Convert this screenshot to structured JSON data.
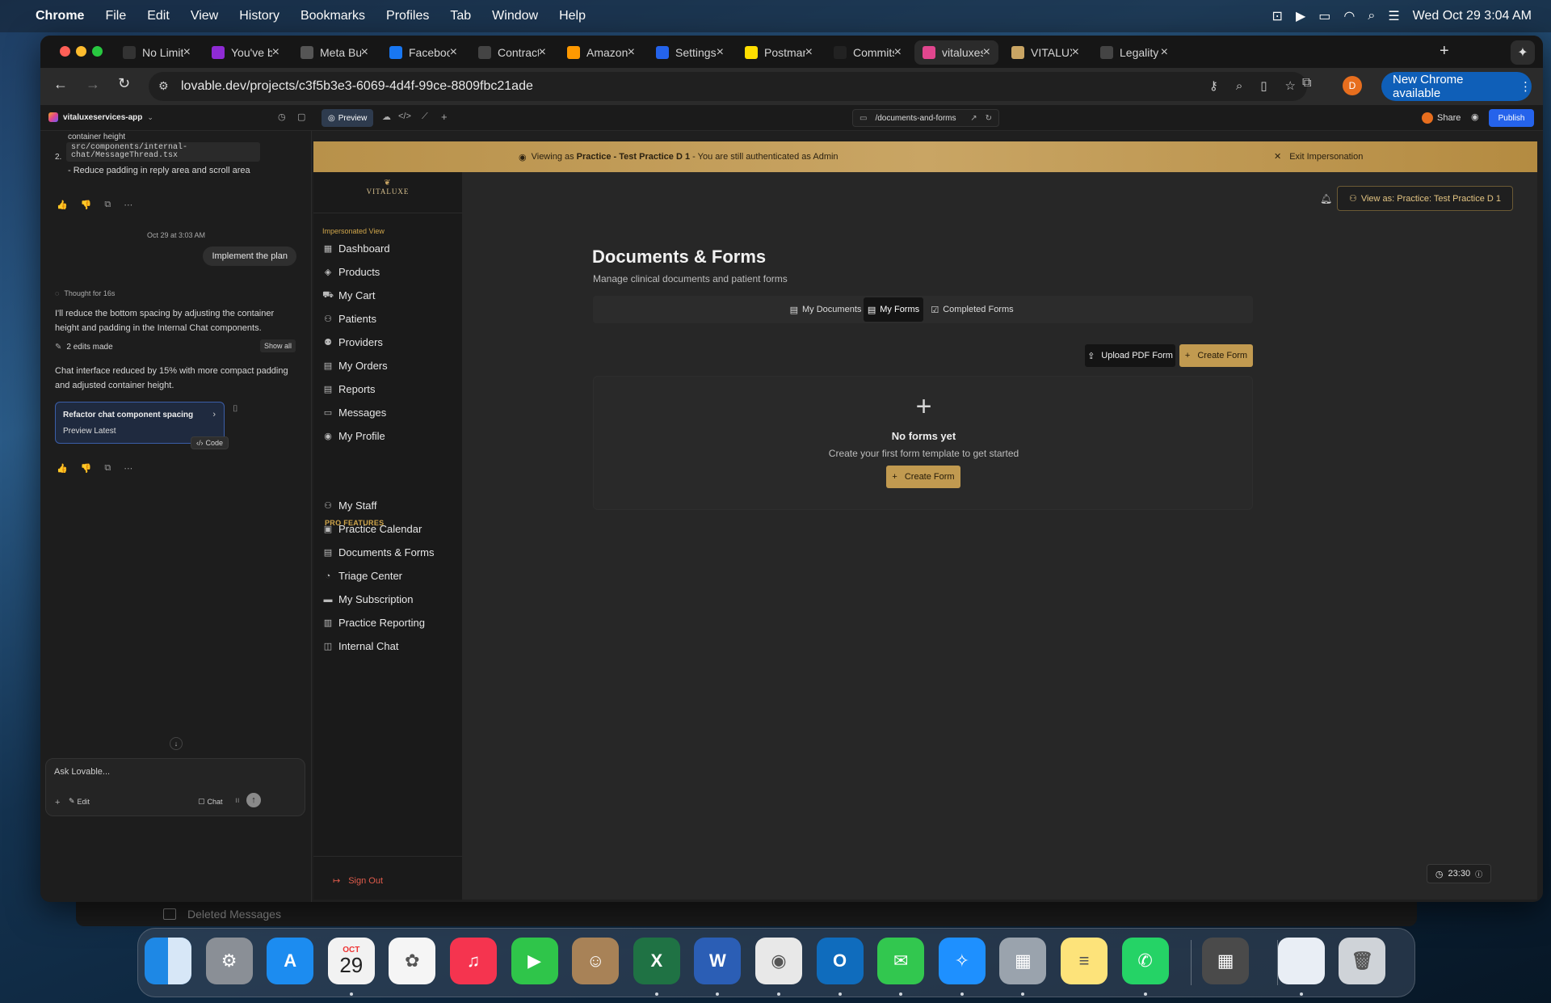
{
  "menubar": {
    "app": "Chrome",
    "items": [
      "File",
      "Edit",
      "View",
      "History",
      "Bookmarks",
      "Profiles",
      "Tab",
      "Window",
      "Help"
    ],
    "clock": "Wed Oct 29  3:04 AM"
  },
  "tabs": [
    {
      "label": "No Limit",
      "icon": "nlc-icon",
      "color": "#333"
    },
    {
      "label": "You've b",
      "icon": "app-icon",
      "color": "#8e2bd4"
    },
    {
      "label": "Meta Bus",
      "icon": "meta-icon",
      "color": "#555"
    },
    {
      "label": "Faceboo",
      "icon": "facebook-icon",
      "color": "#1877f2"
    },
    {
      "label": "Contract",
      "icon": "openai-icon",
      "color": "#444"
    },
    {
      "label": "Amazon",
      "icon": "amazon-icon",
      "color": "#ff9900"
    },
    {
      "label": "Settings",
      "icon": "settings-icon",
      "color": "#2463eb"
    },
    {
      "label": "Postmar",
      "icon": "postmark-icon",
      "color": "#ffde00"
    },
    {
      "label": "Commits",
      "icon": "github-icon",
      "color": "#222"
    },
    {
      "label": "vitaluxes",
      "icon": "lovable-icon",
      "color": "#e0468e"
    },
    {
      "label": "VITALUX",
      "icon": "vitalux-icon",
      "color": "#c9a564"
    },
    {
      "label": "Legality",
      "icon": "openai-icon",
      "color": "#444"
    }
  ],
  "address": {
    "url": "lovable.dev/projects/c3f5b3e3-6069-4d4f-99ce-8809fbc21ade",
    "profile": "D",
    "update": "New Chrome available"
  },
  "lovable": {
    "project": "vitaluxeservices-app",
    "preview": "Preview",
    "route": "/documents-and-forms",
    "share": "Share",
    "publish": "Publish"
  },
  "chat": {
    "line0": "container height",
    "code_path": "src/components/internal-chat/MessageThread.tsx",
    "num": "2.",
    "reduce": "- Reduce padding in reply area and scroll area",
    "timestamp": "Oct 29 at 3:03 AM",
    "user_msg": "Implement the plan",
    "thought": "Thought for 16s",
    "reply": "I'll reduce the bottom spacing by adjusting the container height and padding in the Internal Chat components.",
    "edits": "2 edits made",
    "show_all": "Show all",
    "summary": "Chat interface reduced by 15% with more compact padding and adjusted container height.",
    "card_title": "Refactor chat component spacing",
    "card_sub": "Preview Latest",
    "code_btn": "Code",
    "input_placeholder": "Ask Lovable...",
    "edit_btn": "Edit",
    "chat_btn": "Chat"
  },
  "app": {
    "banner_prefix": "Viewing as ",
    "banner_bold": "Practice - Test Practice D 1",
    "banner_suffix": " - You are still authenticated as Admin",
    "exit": "Exit Impersonation",
    "logo": "VITALUXE",
    "imp_view": "Impersonated View",
    "nav": [
      {
        "label": "Dashboard",
        "icon": "grid-icon"
      },
      {
        "label": "Products",
        "icon": "box-icon"
      },
      {
        "label": "My Cart",
        "icon": "cart-icon"
      },
      {
        "label": "Patients",
        "icon": "users-icon"
      },
      {
        "label": "Providers",
        "icon": "provider-icon"
      },
      {
        "label": "My Orders",
        "icon": "document-icon"
      },
      {
        "label": "Reports",
        "icon": "document-icon"
      },
      {
        "label": "Messages",
        "icon": "message-icon"
      },
      {
        "label": "My Profile",
        "icon": "profile-icon"
      }
    ],
    "pro_label": "PRO FEATURES",
    "pro_nav": [
      {
        "label": "My Staff",
        "icon": "users-icon"
      },
      {
        "label": "Practice Calendar",
        "icon": "calendar-icon"
      },
      {
        "label": "Documents & Forms",
        "icon": "document-icon"
      },
      {
        "label": "Triage Center",
        "icon": "alert-icon"
      },
      {
        "label": "My Subscription",
        "icon": "card-icon"
      },
      {
        "label": "Practice Reporting",
        "icon": "chart-icon"
      },
      {
        "label": "Internal Chat",
        "icon": "chat-icon"
      }
    ],
    "sign_out": "Sign Out",
    "view_as": "View as: Practice: Test Practice D 1",
    "title": "Documents & Forms",
    "subtitle": "Manage clinical documents and patient forms",
    "page_tabs": [
      "My Documents",
      "My Forms",
      "Completed Forms"
    ],
    "active_tab": "My Forms",
    "upload": "Upload PDF Form",
    "create": "Create Form",
    "empty_title": "No forms yet",
    "empty_sub": "Create your first form template to get started",
    "timer": "23:30"
  },
  "behind": {
    "deleted": "Deleted Messages"
  },
  "dock": [
    {
      "name": "finder-icon",
      "color": "#1e88e5",
      "txt": ""
    },
    {
      "name": "system-settings-icon",
      "color": "#8a8f96",
      "txt": "⚙"
    },
    {
      "name": "app-store-icon",
      "color": "#1c8cf0",
      "txt": "A"
    },
    {
      "name": "calendar-icon",
      "color": "#f2f2f2",
      "txt": "29"
    },
    {
      "name": "photos-icon",
      "color": "#f5f5f5",
      "txt": "✿"
    },
    {
      "name": "music-icon",
      "color": "#f5344f",
      "txt": "♫"
    },
    {
      "name": "facetime-icon",
      "color": "#2fc54a",
      "txt": "▶"
    },
    {
      "name": "contacts-icon",
      "color": "#a88257",
      "txt": "☺"
    },
    {
      "name": "excel-icon",
      "color": "#1f7244",
      "txt": "X"
    },
    {
      "name": "word-icon",
      "color": "#2b5eb5",
      "txt": "W"
    },
    {
      "name": "chrome-icon",
      "color": "#e8e8e8",
      "txt": "◉"
    },
    {
      "name": "outlook-icon",
      "color": "#0f6cbd",
      "txt": "O"
    },
    {
      "name": "messages-icon",
      "color": "#32c74f",
      "txt": "✉"
    },
    {
      "name": "safari-icon",
      "color": "#1e90ff",
      "txt": "✧"
    },
    {
      "name": "launchpad-icon",
      "color": "#9aa3ad",
      "txt": "▦"
    },
    {
      "name": "notes-icon",
      "color": "#fde37a",
      "txt": "≡"
    },
    {
      "name": "whatsapp-icon",
      "color": "#25d366",
      "txt": "✆"
    },
    {
      "name": "calculator-icon",
      "color": "#4a4a4a",
      "txt": "▦"
    },
    {
      "name": "preview-icon",
      "color": "#e9eef5",
      "txt": ""
    },
    {
      "name": "trash-icon",
      "color": "#cfd3d8",
      "txt": "🗑"
    }
  ],
  "calendar_month": "OCT"
}
